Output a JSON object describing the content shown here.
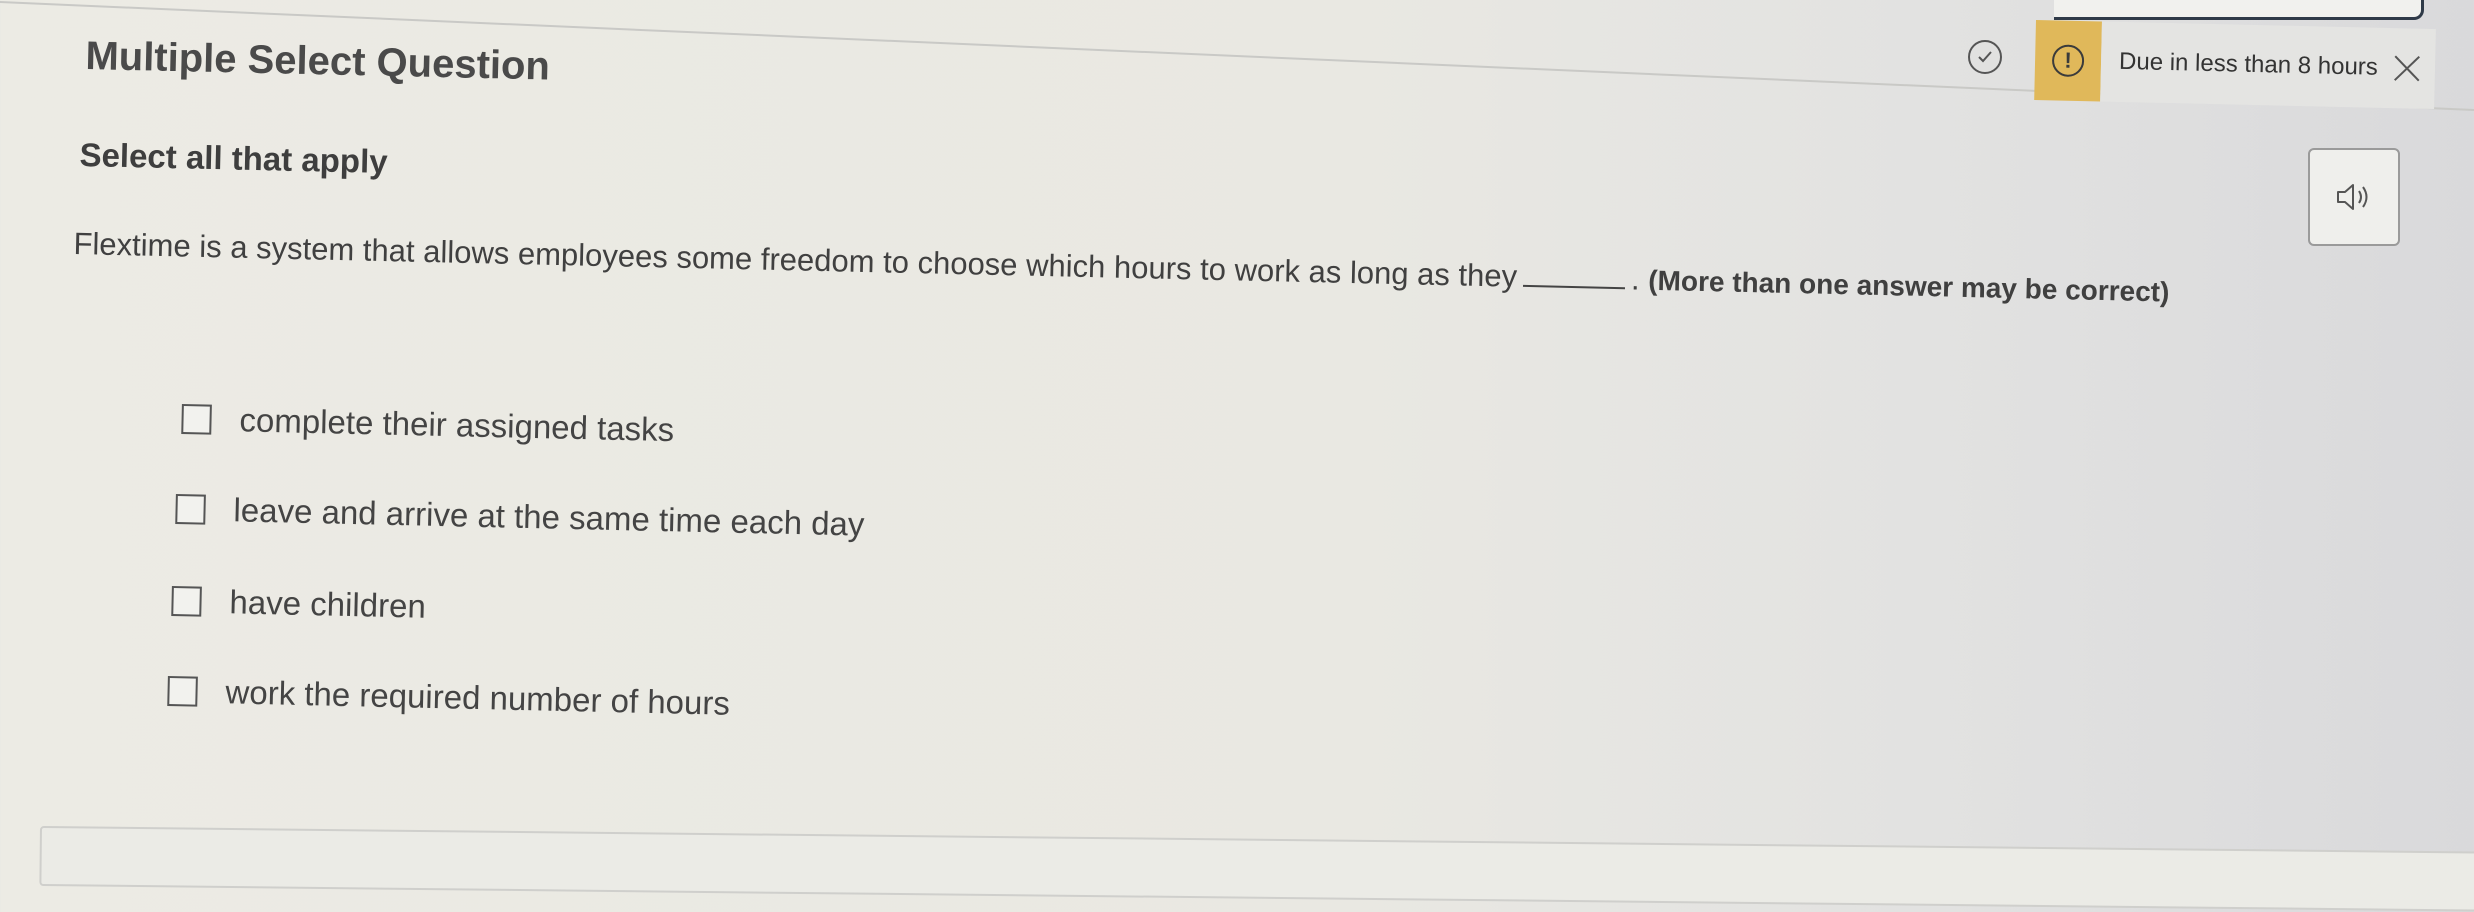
{
  "question": {
    "type_label": "Multiple Select Question",
    "instruction": "Select all that apply",
    "prompt_before_blank": "Flextime is a system that allows employees some freedom to choose which hours to work as long as they",
    "prompt_after_blank": ".",
    "prompt_note": "(More than one answer may be correct)",
    "options": [
      {
        "label": "complete their assigned tasks",
        "checked": false
      },
      {
        "label": "leave and arrive at the same time each day",
        "checked": false
      },
      {
        "label": "have children",
        "checked": false
      },
      {
        "label": "work the required number of hours",
        "checked": false
      }
    ]
  },
  "due_notice": {
    "text": "Due in less than 8 hours",
    "warning_glyph": "!",
    "warning_color": "#e0b85a"
  },
  "icons": {
    "status": "check-circle-icon",
    "audio": "speaker-icon",
    "close": "close-icon",
    "warning": "warning-icon"
  }
}
